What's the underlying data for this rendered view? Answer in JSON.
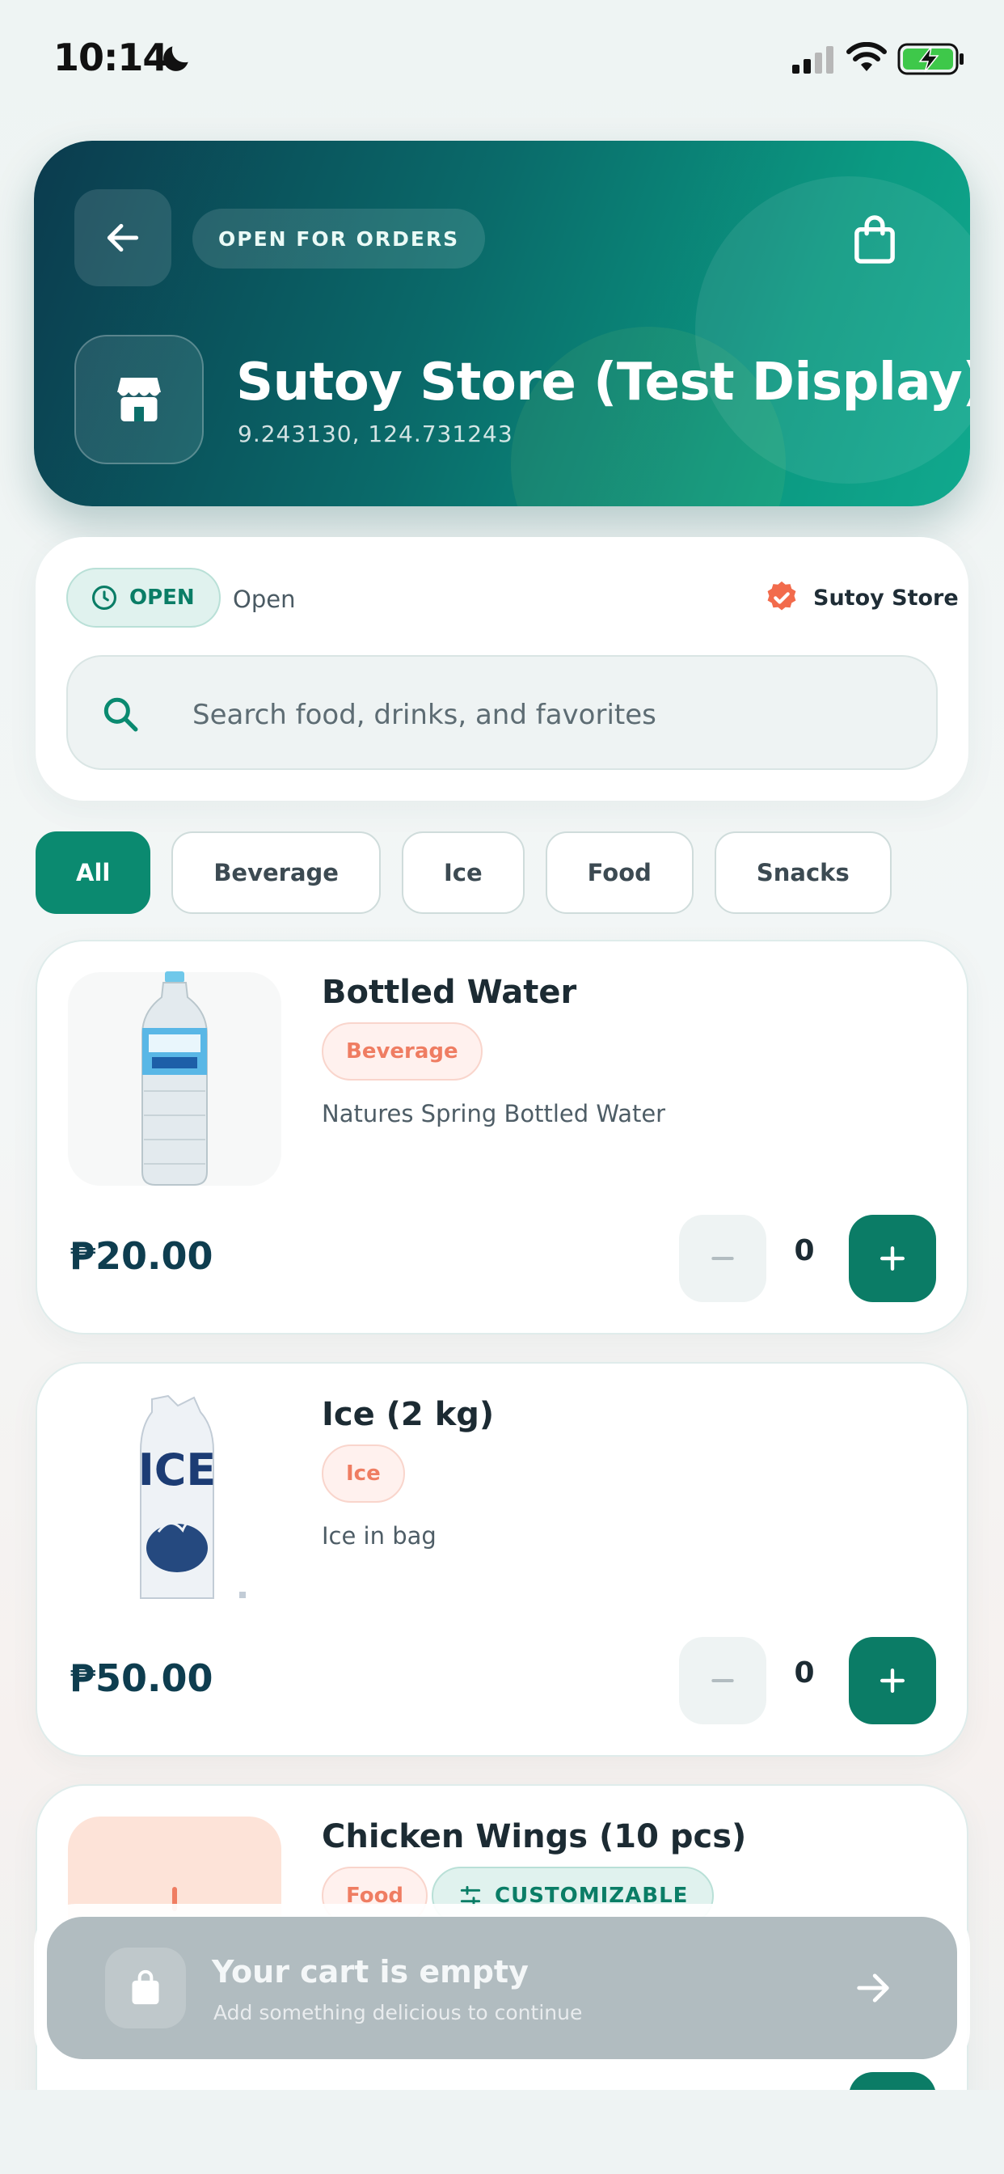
{
  "status_bar": {
    "time": "10:14"
  },
  "header": {
    "status_pill": "OPEN FOR ORDERS",
    "store_name": "Sutoy Store (Test Display)",
    "coordinates": "9.243130, 124.731243"
  },
  "info": {
    "open_badge": "OPEN",
    "open_text": "Open",
    "store_tag": "Sutoy Store",
    "search_placeholder": "Search food, drinks, and favorites"
  },
  "categories": [
    "All",
    "Beverage",
    "Ice",
    "Food",
    "Snacks"
  ],
  "active_category": "All",
  "products": [
    {
      "name": "Bottled Water",
      "tag": "Beverage",
      "description": "Natures Spring Bottled Water",
      "price": "₱20.00",
      "quantity": "0"
    },
    {
      "name": "Ice (2 kg)",
      "tag": "Ice",
      "description": "Ice in bag",
      "price": "₱50.00",
      "quantity": "0"
    },
    {
      "name": "Chicken Wings (10 pcs)",
      "tag": "Food",
      "tag2": "CUSTOMIZABLE"
    }
  ],
  "cart": {
    "title": "Your cart is empty",
    "subtitle": "Add something delicious to continue"
  },
  "colors": {
    "brand": "#0b7c66",
    "accent": "#ef7d62",
    "dark": "#0e3d4f"
  },
  "icons": [
    "moon-icon",
    "signal-icon",
    "wifi-icon",
    "battery-icon",
    "back-arrow-icon",
    "shopping-bag-icon",
    "store-icon",
    "clock-icon",
    "verified-badge-icon",
    "search-icon",
    "minus-icon",
    "plus-icon",
    "sliders-icon",
    "arrow-right-icon"
  ]
}
